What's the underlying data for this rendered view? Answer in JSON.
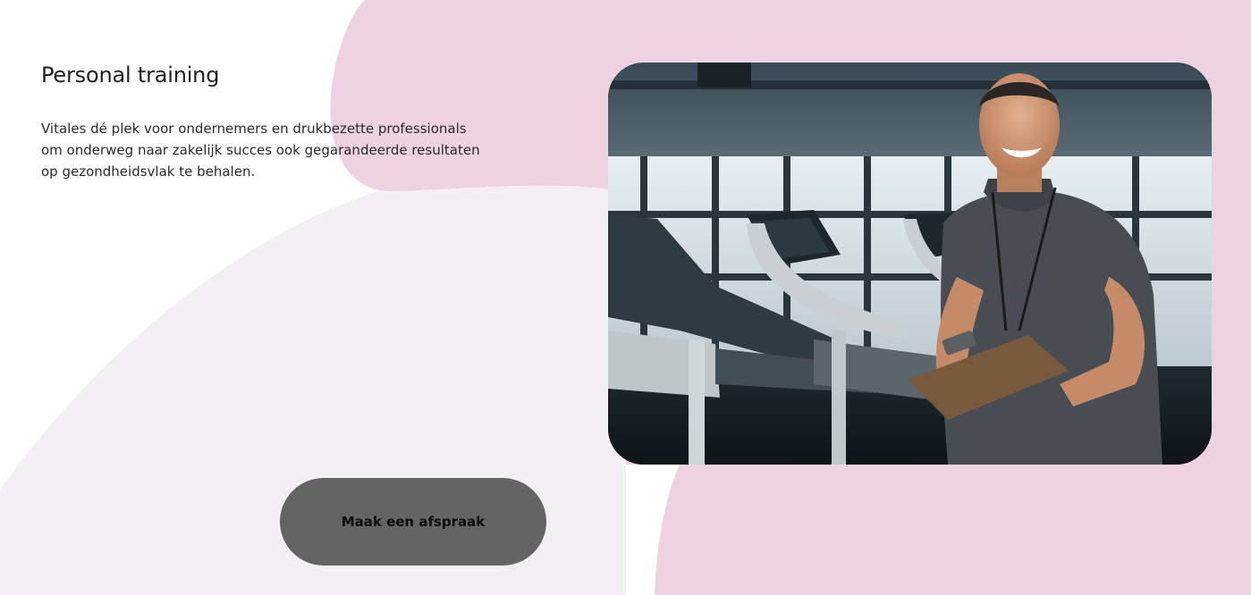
{
  "section": {
    "title": "Personal training",
    "description": "Vitales dé plek voor ondernemers en drukbezette professionals om onderweg naar zakelijk succes ook gegarandeerde resultaten op gezondheidsvlak te behalen."
  },
  "cta": {
    "label": "Maak een afspraak"
  },
  "image": {
    "subject": "personal-trainer-with-clipboard-in-gym"
  },
  "colors": {
    "pink_blob": "#eed2e1",
    "lavender_blob": "#f4eff5",
    "button_bg": "#646464",
    "text": "#1f1f1f"
  }
}
